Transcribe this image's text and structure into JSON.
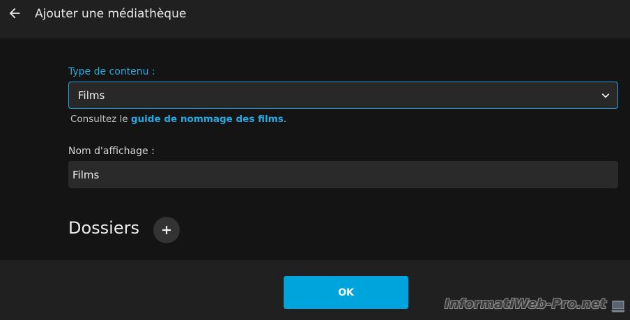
{
  "header": {
    "back_icon": "arrow-left-icon",
    "title": "Ajouter une médiathèque"
  },
  "form": {
    "content_type_label": "Type de contenu :",
    "content_type_value": "Films",
    "help_prefix": "Consultez le ",
    "help_link": "guide de nommage des films",
    "help_suffix": ".",
    "display_name_label": "Nom d'affichage :",
    "display_name_value": "Films"
  },
  "folders": {
    "title": "Dossiers",
    "add_icon": "plus-icon"
  },
  "footer": {
    "ok_label": "OK"
  },
  "watermark": {
    "text": "InformatiWeb-Pro.net"
  },
  "colors": {
    "accent": "#00a4dc",
    "link": "#28a8e0",
    "background": "#141414",
    "header": "#202020"
  }
}
